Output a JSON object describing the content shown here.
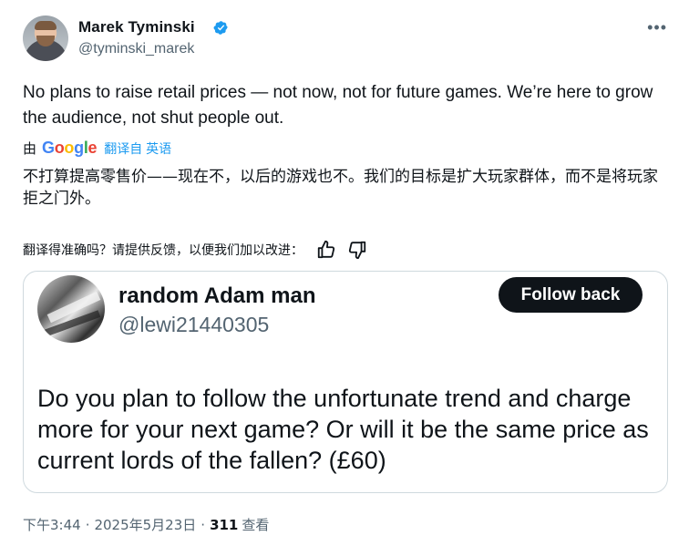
{
  "author": {
    "name": "Marek Tyminski",
    "handle": "@tyminski_marek",
    "verified_icon": "verified-badge-icon"
  },
  "more_icon": "more-horizontal-icon",
  "tweet": {
    "text": "No plans to raise retail prices — not now, not for future games. We’re here to grow the audience, not shut people out."
  },
  "translation": {
    "by_label": "由",
    "google_letters": [
      "G",
      "o",
      "o",
      "g",
      "l",
      "e"
    ],
    "link_label": "翻译自 英语",
    "text": "不打算提高零售价——现在不，以后的游戏也不。我们的目标是扩大玩家群体，而不是将玩家拒之门外。",
    "feedback_prompt": "翻译得准确吗？请提供反馈，以便我们加以改进："
  },
  "quote": {
    "name": "random Adam man",
    "handle": "@lewi21440305",
    "follow_label": "Follow back",
    "text": "Do you plan to follow the unfortunate trend and charge more for your next game? Or will it be the same price as current lords of the fallen? (£60)"
  },
  "meta": {
    "time": "下午3:44",
    "separator": "·",
    "date": "2025年5月23日",
    "views_count": "311",
    "views_label": "查看"
  },
  "colors": {
    "text": "#0f1419",
    "secondary": "#536471",
    "link": "#1d9bf0",
    "verified": "#1d9bf0",
    "border": "#cfd9de",
    "button_bg": "#0f1419"
  }
}
